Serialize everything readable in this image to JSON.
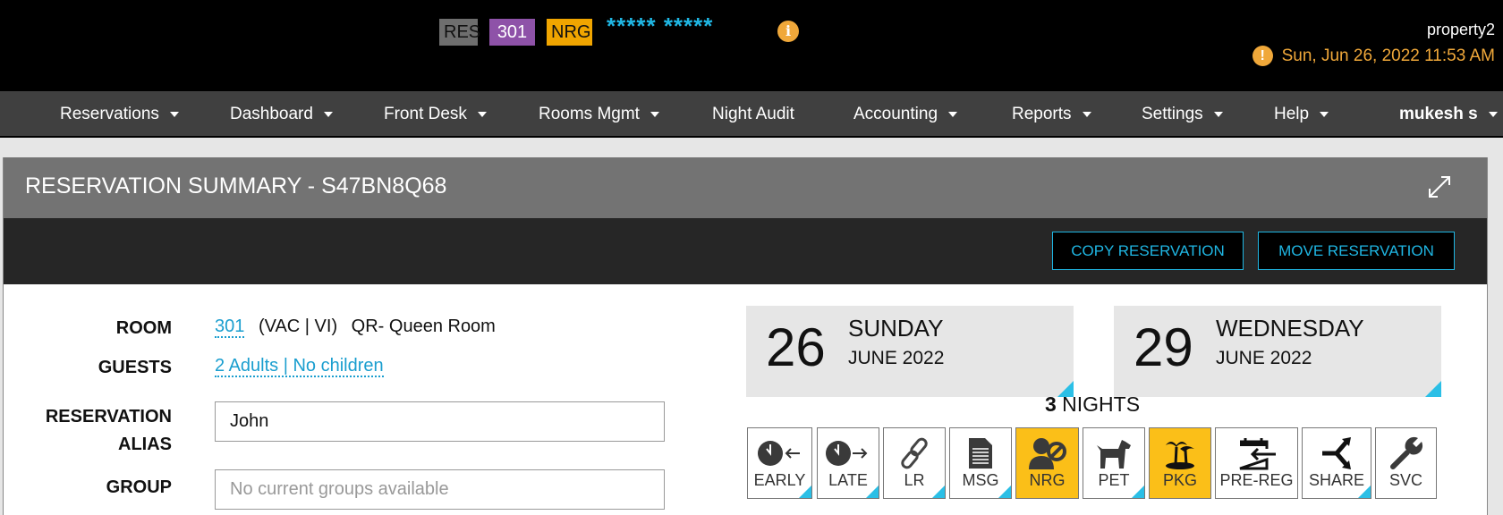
{
  "header": {
    "badges": {
      "type": "RES",
      "room": "301",
      "status": "NRG"
    },
    "guest_name_masked": "***** *****",
    "info_icon": "info-icon",
    "property": "property2",
    "datetime": "Sun, Jun 26, 2022 11:53 AM",
    "warning_icon": "exclamation-icon"
  },
  "nav": {
    "items": [
      {
        "label": "Reservations",
        "dropdown": true
      },
      {
        "label": "Dashboard",
        "dropdown": true
      },
      {
        "label": "Front Desk",
        "dropdown": true
      },
      {
        "label": "Rooms Mgmt",
        "dropdown": true
      },
      {
        "label": "Night Audit",
        "dropdown": false
      },
      {
        "label": "Accounting",
        "dropdown": true
      },
      {
        "label": "Reports",
        "dropdown": true
      },
      {
        "label": "Settings",
        "dropdown": true
      },
      {
        "label": "Help",
        "dropdown": true
      }
    ],
    "user": "mukesh s"
  },
  "panel": {
    "title": "RESERVATION SUMMARY - S47BN8Q68",
    "expand_icon": "expand-icon",
    "toolbar": {
      "copy_label": "COPY RESERVATION",
      "move_label": "MOVE RESERVATION"
    },
    "form": {
      "room_label": "ROOM",
      "room_number": "301",
      "room_status": "(VAC | VI)",
      "room_type": "QR- Queen Room",
      "guests_label": "GUESTS",
      "guests_value": "2 Adults | No children",
      "alias_label_line1": "RESERVATION",
      "alias_label_line2": "ALIAS",
      "alias_value": "John",
      "group_label": "GROUP",
      "group_placeholder": "No current groups available"
    },
    "arrival": {
      "day": "26",
      "weekday": "SUNDAY",
      "month_year": "JUNE 2022"
    },
    "departure": {
      "day": "29",
      "weekday": "WEDNESDAY",
      "month_year": "JUNE 2022"
    },
    "nights": {
      "count": "3",
      "label": "NIGHTS"
    },
    "tiles": [
      {
        "label": "EARLY",
        "icon": "clock-arrow-left-icon",
        "active": false,
        "corner": true
      },
      {
        "label": "LATE",
        "icon": "clock-arrow-right-icon",
        "active": false,
        "corner": true
      },
      {
        "label": "LR",
        "icon": "link-icon",
        "active": false,
        "corner": true
      },
      {
        "label": "MSG",
        "icon": "document-icon",
        "active": false,
        "corner": true
      },
      {
        "label": "NRG",
        "icon": "user-blocked-icon",
        "active": true,
        "corner": false
      },
      {
        "label": "PET",
        "icon": "dog-icon",
        "active": false,
        "corner": true
      },
      {
        "label": "PKG",
        "icon": "palm-tree-icon",
        "active": true,
        "corner": false
      },
      {
        "label": "PRE-REG",
        "icon": "calendar-arrow-icon",
        "active": false,
        "corner": false
      },
      {
        "label": "SHARE",
        "icon": "share-icon",
        "active": false,
        "corner": true
      },
      {
        "label": "SVC",
        "icon": "wrench-icon",
        "active": false,
        "corner": false
      }
    ]
  },
  "colors": {
    "accent_blue": "#1fb6e3",
    "active_yellow": "#fbbf18",
    "warning_orange": "#f0a83a",
    "room_badge_purple": "#8e52a8",
    "nrg_badge_orange": "#f0a500"
  }
}
